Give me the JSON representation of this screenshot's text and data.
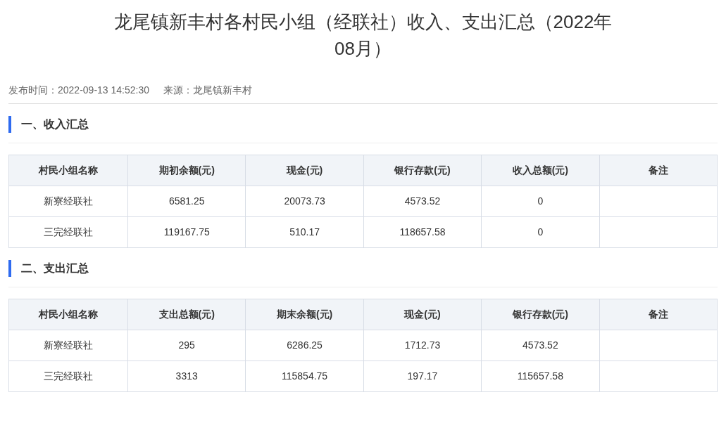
{
  "title": "龙尾镇新丰村各村民小组（经联社）收入、支出汇总（2022年08月）",
  "meta": [
    "发布时间：2022-09-13 14:52:30",
    "来源：龙尾镇新丰村"
  ],
  "sections": [
    {
      "heading": "一、收入汇总",
      "table": {
        "columns": [
          "村民小组名称",
          "期初余额(元)",
          "现金(元)",
          "银行存款(元)",
          "收入总额(元)",
          "备注"
        ],
        "rows": [
          [
            "新寮经联社",
            "6581.25",
            "20073.73",
            "4573.52",
            "0"
          ],
          [
            "三完经联社",
            "119167.75",
            "510.17",
            "118657.58",
            "0"
          ]
        ]
      }
    },
    {
      "heading": "二、支出汇总",
      "table": {
        "columns": [
          "村民小组名称",
          "支出总额(元)",
          "期末余额(元)",
          "现金(元)",
          "银行存款(元)",
          "备注"
        ],
        "rows": [
          [
            "新寮经联社",
            "295",
            "6286.25",
            "1712.73",
            "4573.52"
          ],
          [
            "三完经联社",
            "3313",
            "115854.75",
            "197.17",
            "115657.58"
          ]
        ]
      }
    }
  ]
}
